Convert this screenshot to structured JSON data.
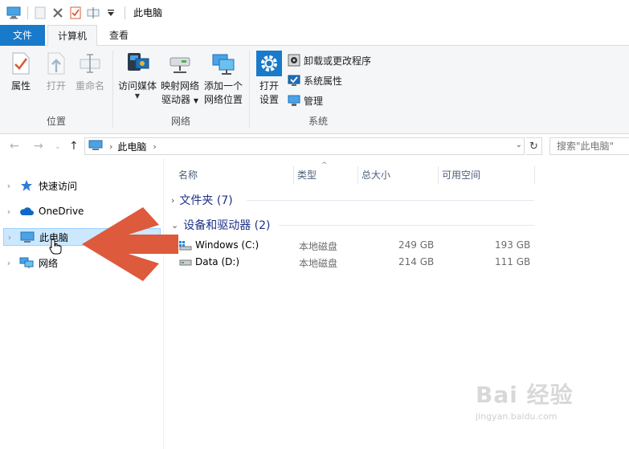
{
  "titlebar": {
    "title": "此电脑",
    "icons": [
      "computer-icon",
      "blank-page-icon",
      "delete-icon",
      "properties-icon",
      "rename-icon",
      "customize-dropdown-icon"
    ]
  },
  "tabs": {
    "file": "文件",
    "computer": "计算机",
    "view": "查看"
  },
  "ribbon": {
    "location": {
      "label": "位置",
      "properties": "属性",
      "open": "打开",
      "rename": "重命名"
    },
    "network": {
      "label": "网络",
      "access_media": "访问媒体",
      "map_drive_line1": "映射网络",
      "map_drive_line2": "驱动器",
      "add_location_line1": "添加一个",
      "add_location_line2": "网络位置"
    },
    "system": {
      "label": "系统",
      "open_settings_line1": "打开",
      "open_settings_line2": "设置",
      "uninstall": "卸载或更改程序",
      "system_properties": "系统属性",
      "manage": "管理"
    }
  },
  "address": {
    "crumb": "此电脑",
    "search_placeholder": "搜索\"此电脑\""
  },
  "navpane": {
    "items": [
      {
        "label": "快速访问",
        "icon": "star-icon"
      },
      {
        "label": "OneDrive",
        "icon": "cloud-icon"
      },
      {
        "label": "此电脑",
        "icon": "computer-icon",
        "selected": true
      },
      {
        "label": "网络",
        "icon": "network-icon"
      }
    ]
  },
  "columns": {
    "name": "名称",
    "type": "类型",
    "total": "总大小",
    "free": "可用空间"
  },
  "groups": {
    "folders": "文件夹 (7)",
    "devices": "设备和驱动器 (2)"
  },
  "drives": [
    {
      "name": "Windows (C:)",
      "type": "本地磁盘",
      "total": "249 GB",
      "free": "193 GB"
    },
    {
      "name": "Data (D:)",
      "type": "本地磁盘",
      "total": "214 GB",
      "free": "111 GB"
    }
  ],
  "colors": {
    "accent": "#1979ca",
    "selection": "#cce8ff",
    "arrow": "#dd5a3c",
    "group_text": "#1e3287"
  },
  "watermark": {
    "brand": "Bai 经验",
    "url": "jingyan.baidu.com"
  }
}
